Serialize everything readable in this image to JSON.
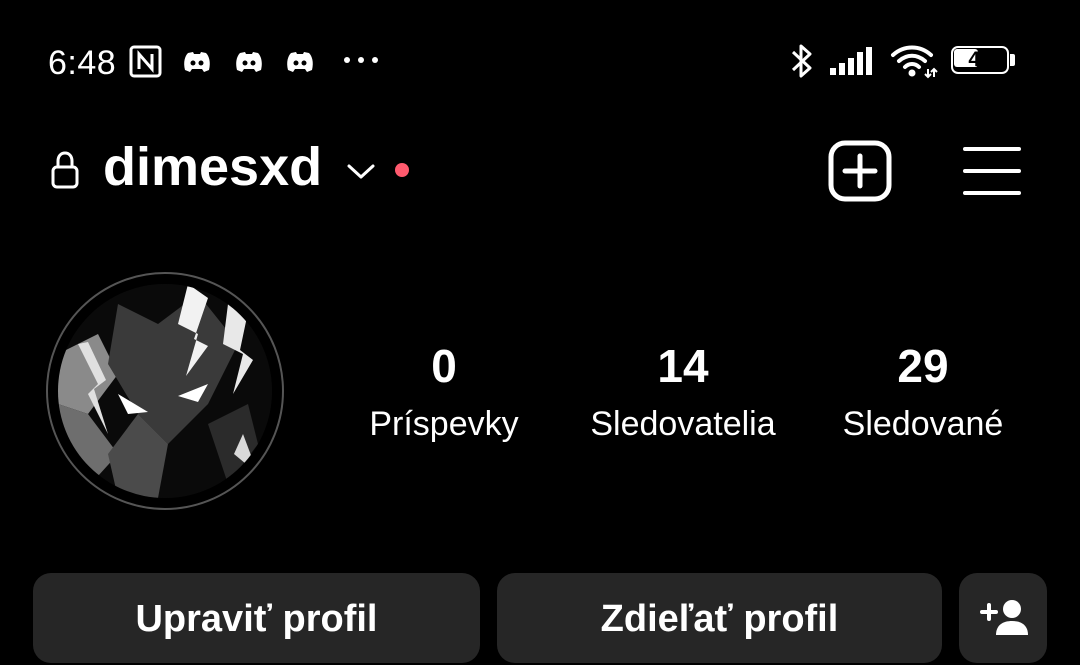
{
  "status_bar": {
    "time": "6:48",
    "battery_level": "47",
    "icons": [
      "nfc-icon",
      "discord-icon",
      "discord-icon",
      "discord-icon",
      "more-icon",
      "bluetooth-icon",
      "signal-icon",
      "wifi-icon",
      "battery-icon"
    ]
  },
  "header": {
    "username": "dimesxd",
    "icons": [
      "lock-icon",
      "chevron-down-icon",
      "new-post-icon",
      "menu-icon"
    ],
    "notification_dot_color": "#ff5a6e"
  },
  "profile": {
    "stats": [
      {
        "value": "0",
        "label": "Príspevky"
      },
      {
        "value": "14",
        "label": "Sledovatelia"
      },
      {
        "value": "29",
        "label": "Sledované"
      }
    ]
  },
  "actions": {
    "edit_label": "Upraviť profil",
    "share_label": "Zdieľať profil",
    "add_icon": "add-user-icon"
  },
  "colors": {
    "background": "#000000",
    "button_bg": "#262626",
    "text": "#ffffff"
  }
}
